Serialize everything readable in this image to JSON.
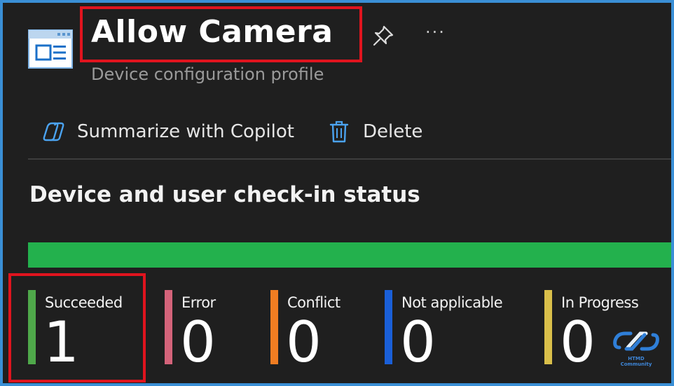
{
  "header": {
    "title": "Allow Camera",
    "subtitle": "Device configuration profile",
    "more_glyph": "···"
  },
  "commands": [
    {
      "label": "Summarize with Copilot",
      "icon": "copilot-icon"
    },
    {
      "label": "Delete",
      "icon": "trash-icon"
    }
  ],
  "section": {
    "title": "Device and user check-in status"
  },
  "status_bar": {
    "succeeded_fraction": 1.0,
    "color": "#23b14d"
  },
  "tiles": [
    {
      "label": "Succeeded",
      "value": "1",
      "color": "#4fa84a"
    },
    {
      "label": "Error",
      "value": "0",
      "color": "#d4637a"
    },
    {
      "label": "Conflict",
      "value": "0",
      "color": "#f07d22"
    },
    {
      "label": "Not applicable",
      "value": "0",
      "color": "#1a5fd8"
    },
    {
      "label": "In Progress",
      "value": "0",
      "color": "#d9bf4a"
    }
  ],
  "watermark": {
    "text": "HTMD Community"
  },
  "colors": {
    "background": "#1f1f1f",
    "accent": "#3a8fd6",
    "highlight": "#e0141e"
  }
}
